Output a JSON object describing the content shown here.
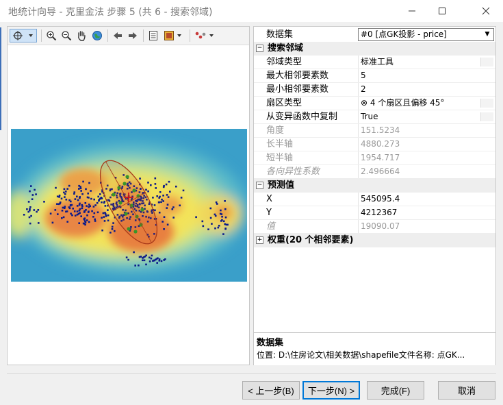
{
  "window": {
    "title": "地统计向导 - 克里金法 步骤 5 (共 6 - 搜索邻域)"
  },
  "toolbar": {
    "icons": [
      "select-icon",
      "zoom-in-icon",
      "zoom-out-icon",
      "pan-icon",
      "full-extent-icon",
      "back-icon",
      "forward-icon",
      "table-icon",
      "legend-icon",
      "symbol-icon"
    ]
  },
  "properties": {
    "dataset_label": "数据集",
    "dataset_value": "#0 [点GK投影 - price]",
    "search_category": "搜索邻域",
    "rows": [
      {
        "label": "邻域类型",
        "value": "标准工具"
      },
      {
        "label": "最大相邻要素数",
        "value": "5"
      },
      {
        "label": "最小相邻要素数",
        "value": "2"
      },
      {
        "label": "扇区类型",
        "value": "⊗ 4 个扇区且偏移 45°"
      },
      {
        "label": "从变异函数中复制",
        "value": "True"
      },
      {
        "label": "角度",
        "value": "151.5234"
      },
      {
        "label": "长半轴",
        "value": "4880.273"
      },
      {
        "label": "短半轴",
        "value": "1954.717"
      },
      {
        "label": "各向异性系数",
        "value": "2.496664"
      }
    ],
    "predict_category": "预测值",
    "predict_rows": [
      {
        "label": "X",
        "value": "545095.4"
      },
      {
        "label": "Y",
        "value": "4212367"
      },
      {
        "label": "值",
        "value": "19090.07"
      }
    ],
    "weights_category": "权重(20 个相邻要素)"
  },
  "description": {
    "title": "数据集",
    "text": "位置: D:\\住房论文\\相关数据\\shapefile文件名称: 点GK..."
  },
  "buttons": {
    "back": "< 上一步(B)",
    "next": "下一步(N) >",
    "finish": "完成(F)",
    "cancel": "取消"
  },
  "colors": {
    "map_low": "#3a9fc9",
    "map_mid": "#f3e35a",
    "map_high": "#e0763f",
    "points": "#0b1a8a",
    "neighbors": "#1fa02a",
    "ellipse": "#a83a1a"
  }
}
